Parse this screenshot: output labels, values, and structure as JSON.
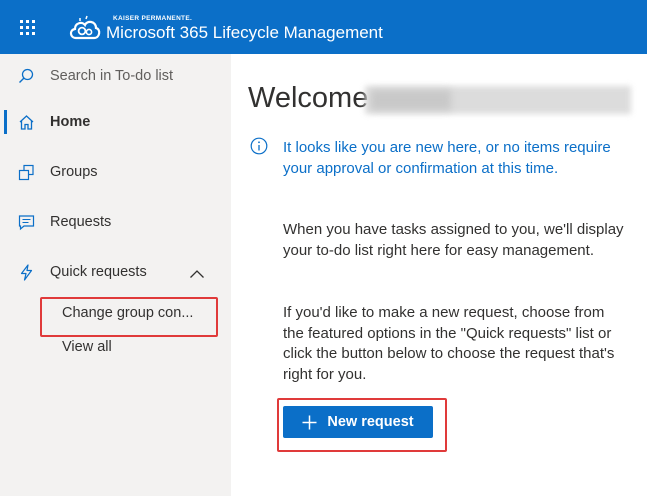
{
  "header": {
    "brand_small": "KAISER PERMANENTE.",
    "app_title": "Microsoft 365 Lifecycle Management",
    "waffle_icon": "waffle-icon",
    "logo_icon": "cloud-gear-logo"
  },
  "sidebar": {
    "search_placeholder": "Search in To-do list",
    "items": [
      {
        "label": "Home",
        "icon": "home-icon",
        "active": true
      },
      {
        "label": "Groups",
        "icon": "groups-icon"
      },
      {
        "label": "Requests",
        "icon": "chat-icon"
      },
      {
        "label": "Quick requests",
        "icon": "lightning-icon",
        "expanded": true
      }
    ],
    "quick_requests_subitems": [
      {
        "label": "Change group con..."
      },
      {
        "label": "View all"
      }
    ]
  },
  "main": {
    "welcome": "Welcome",
    "info_message": "It looks like you are new here, or no items require your approval or confirmation at this time.",
    "paragraph1": "When you have tasks assigned to you, we'll display your to-do list right here for easy management.",
    "paragraph2": "If you'd like to make a new request, choose from the featured options in the \"Quick requests\" list or click the button below to choose the request that's right for you.",
    "new_request_label": "New request"
  },
  "colors": {
    "accent": "#0b6fc8",
    "highlight": "#e03a3a",
    "sidebar_bg": "#f3f2f1"
  }
}
